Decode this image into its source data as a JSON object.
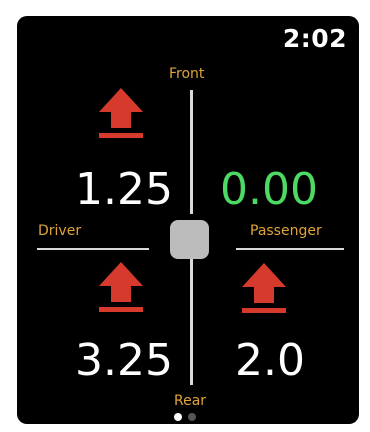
{
  "status": {
    "time": "2:02"
  },
  "labels": {
    "front": "Front",
    "rear": "Rear",
    "driver": "Driver",
    "passenger": "Passenger"
  },
  "wheels": {
    "front_left": {
      "value": "1.25",
      "icon": "raise-up-arrow-icon",
      "color": "#ffffff"
    },
    "front_right": {
      "value": "0.00",
      "icon": "none",
      "color": "#4cd964"
    },
    "rear_left": {
      "value": "3.25",
      "icon": "raise-up-arrow-icon",
      "color": "#ffffff"
    },
    "rear_right": {
      "value": "2.0",
      "icon": "raise-up-arrow-icon",
      "color": "#ffffff"
    }
  },
  "colors": {
    "arrow": "#d63a2c",
    "label": "#e0a43a",
    "level_ok": "#4cd964",
    "background": "#000000"
  },
  "pagination": {
    "pages": 2,
    "current": 1
  }
}
